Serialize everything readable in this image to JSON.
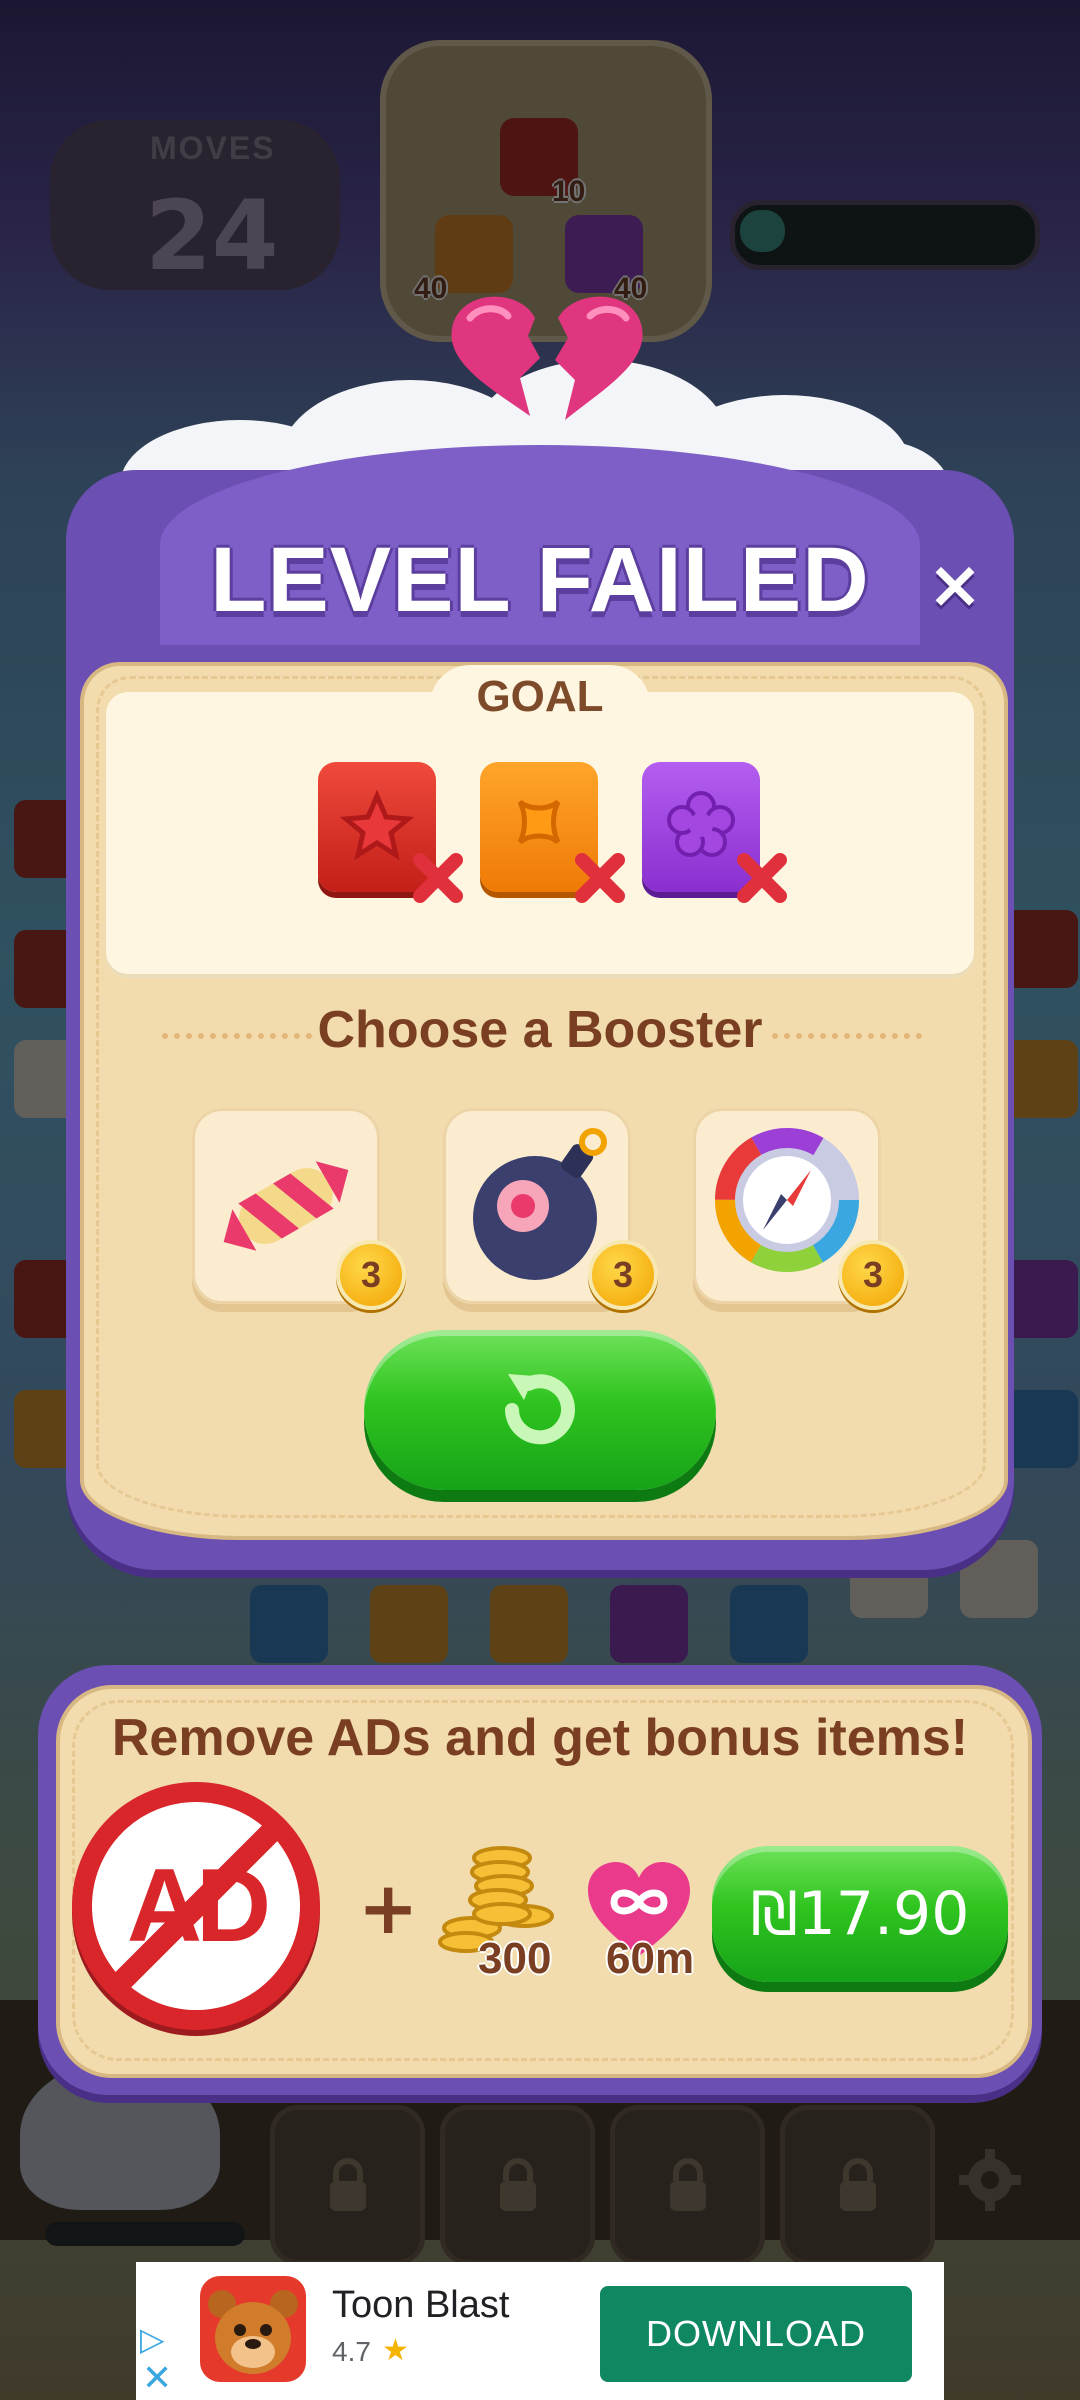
{
  "background": {
    "moves_label": "MOVES",
    "moves_count": "24",
    "goal_counts": [
      "10",
      "40",
      "40"
    ]
  },
  "dialog": {
    "title": "LEVEL FAILED",
    "close_label": "×",
    "goal_label": "GOAL",
    "goal_tiles": [
      {
        "color": "#d62a22",
        "icon": "star-tile-icon"
      },
      {
        "color": "#f07f0c",
        "icon": "cross-tile-icon"
      },
      {
        "color": "#9b3fd6",
        "icon": "flower-tile-icon"
      }
    ],
    "booster_heading": "Choose a Booster",
    "boosters": [
      {
        "icon": "rocket-booster-icon",
        "count": "3"
      },
      {
        "icon": "bomb-booster-icon",
        "count": "3"
      },
      {
        "icon": "compass-booster-icon",
        "count": "3"
      }
    ],
    "retry_icon": "retry-icon"
  },
  "offer": {
    "title": "Remove ADs and get bonus items!",
    "no_ads_text": "AD",
    "plus": "+",
    "coins_amount": "300",
    "hearts_amount": "60m",
    "price": "₪17.90"
  },
  "ad": {
    "app_name": "Toon Blast",
    "rating": "4.7",
    "star": "★",
    "cta": "DOWNLOAD",
    "close": "✕"
  },
  "colors": {
    "dialog_purple": "#6b4fb3",
    "panel_cream": "#f2dcae",
    "text_brown": "#7a3f22",
    "button_green": "#2fc41f",
    "download_green": "#0f8762"
  }
}
